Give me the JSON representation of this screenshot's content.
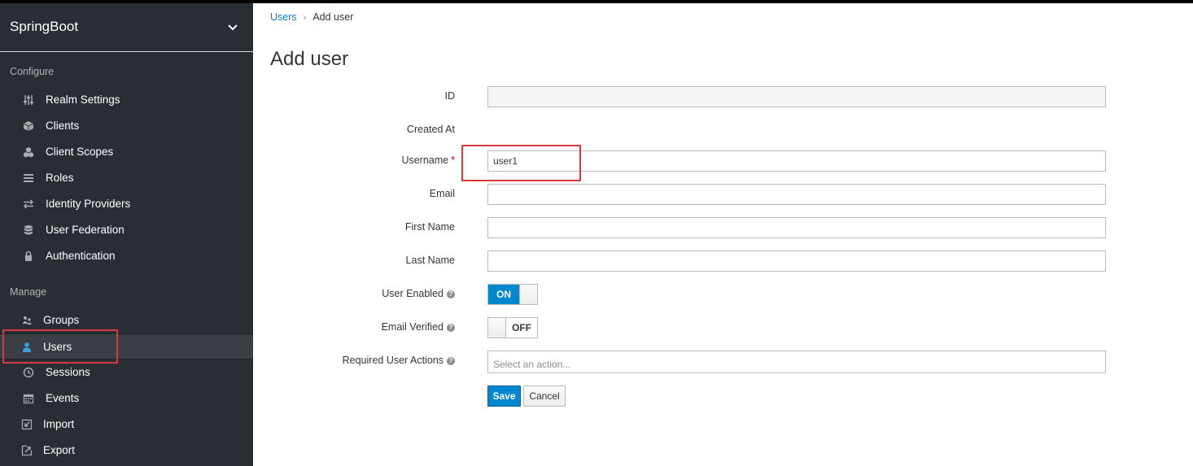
{
  "realm": {
    "name": "SpringBoot"
  },
  "sidebar": {
    "configure_label": "Configure",
    "manage_label": "Manage",
    "configure_items": [
      {
        "label": "Realm Settings",
        "icon": "sliders-icon"
      },
      {
        "label": "Clients",
        "icon": "cube-icon"
      },
      {
        "label": "Client Scopes",
        "icon": "cubes-icon"
      },
      {
        "label": "Roles",
        "icon": "list-icon"
      },
      {
        "label": "Identity Providers",
        "icon": "exchange-icon"
      },
      {
        "label": "User Federation",
        "icon": "database-icon"
      },
      {
        "label": "Authentication",
        "icon": "lock-icon"
      }
    ],
    "manage_items": [
      {
        "label": "Groups",
        "icon": "users-group-icon"
      },
      {
        "label": "Users",
        "icon": "user-icon",
        "active": true
      },
      {
        "label": "Sessions",
        "icon": "clock-icon"
      },
      {
        "label": "Events",
        "icon": "calendar-icon"
      },
      {
        "label": "Import",
        "icon": "import-icon"
      },
      {
        "label": "Export",
        "icon": "export-icon"
      }
    ]
  },
  "breadcrumb": {
    "parent": "Users",
    "separator": "›",
    "current": "Add user"
  },
  "page": {
    "title": "Add user"
  },
  "form": {
    "id_label": "ID",
    "id_value": "",
    "created_at_label": "Created At",
    "username_label": "Username",
    "username_required_mark": "*",
    "username_value": "user1",
    "email_label": "Email",
    "email_value": "",
    "first_name_label": "First Name",
    "first_name_value": "",
    "last_name_label": "Last Name",
    "last_name_value": "",
    "user_enabled_label": "User Enabled",
    "user_enabled_state": "ON",
    "email_verified_label": "Email Verified",
    "email_verified_state": "OFF",
    "required_actions_label": "Required User Actions",
    "required_actions_placeholder": "Select an action...",
    "help_glyph": "?"
  },
  "buttons": {
    "save": "Save",
    "cancel": "Cancel"
  },
  "colors": {
    "sidebar_bg": "#292e34",
    "accent": "#0088ce",
    "highlight": "#d9383f"
  }
}
